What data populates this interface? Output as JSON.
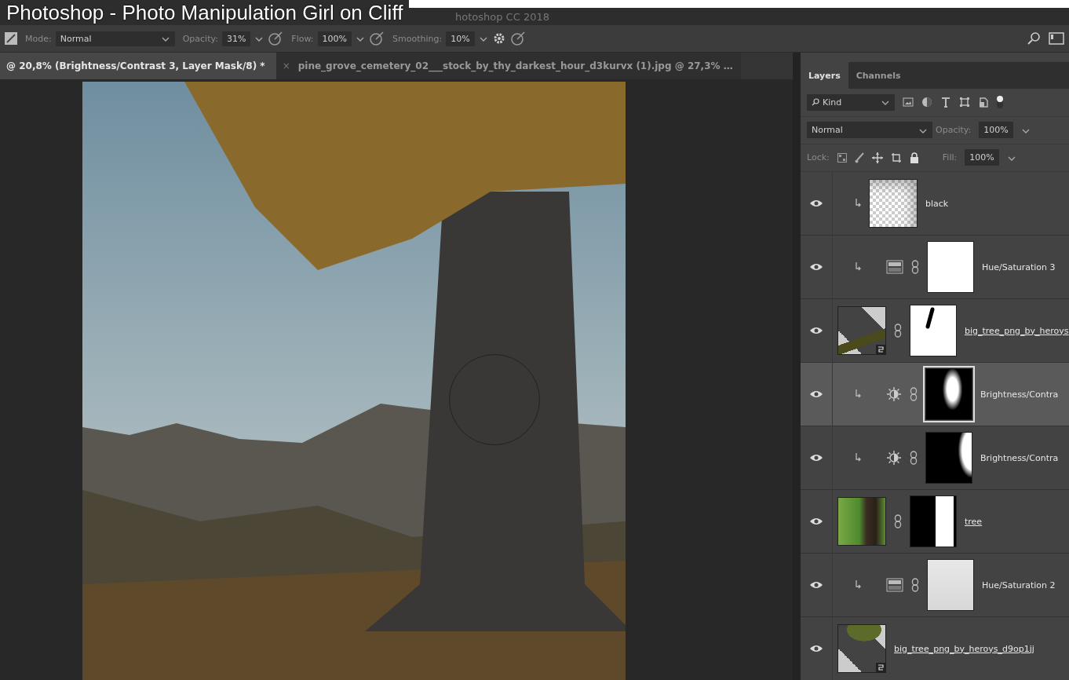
{
  "video_title": "Photoshop - Photo Manipulation Girl on Cliff",
  "window": {
    "title": "hotoshop CC 2018"
  },
  "options_bar": {
    "fields": [
      {
        "label": "Mode:",
        "value": "Normal",
        "kind": "wide"
      },
      {
        "label": "Opacity:",
        "value": "31%",
        "kind": "narrow"
      },
      {
        "label": "Flow:",
        "value": "100%",
        "kind": "narrow"
      },
      {
        "label": "Smoothing:",
        "value": "10%",
        "kind": "narrow"
      }
    ]
  },
  "document_tabs": [
    {
      "label": "@ 20,8% (Brightness/Contrast 3, Layer Mask/8) *",
      "selected": true
    },
    {
      "close": "×",
      "label": "pine_grove_cemetery_02___stock_by_thy_darkest_hour_d3kurvx (1).jpg @ 27,3% …",
      "selected": false
    }
  ],
  "panel": {
    "tabs": [
      {
        "label": "Layers",
        "selected": true
      },
      {
        "label": "Channels",
        "selected": false
      }
    ],
    "filter": "Kind",
    "blend_mode": "Normal",
    "opacity_label": "Opacity:",
    "opacity": "100%",
    "lock_label": "Lock:",
    "fill_label": "Fill:",
    "fill": "100%",
    "layers": [
      {
        "name": "black",
        "visible": true,
        "clipped": true,
        "kind": "pixel",
        "thumbnail": {
          "kind": "checker-corner"
        },
        "linked_name": false,
        "selected": false
      },
      {
        "name": "Hue/Saturation 3",
        "visible": true,
        "clipped": true,
        "kind": "hue",
        "mask": {
          "kind": "white"
        },
        "linked_name": false,
        "selected": false
      },
      {
        "name": "big_tree_png_by_heroys",
        "visible": true,
        "clipped": false,
        "kind": "smart",
        "thumbnail": {
          "kind": "checker-tree"
        },
        "mask": {
          "kind": "stroke"
        },
        "linked_name": true,
        "selected": false
      },
      {
        "name": "Brightness/Contra",
        "visible": true,
        "clipped": true,
        "kind": "brightness",
        "mask": {
          "kind": "glow-center"
        },
        "linked_name": false,
        "selected": true
      },
      {
        "name": "Brightness/Contra",
        "visible": true,
        "clipped": true,
        "kind": "brightness",
        "mask": {
          "kind": "glow-right"
        },
        "linked_name": false,
        "selected": false
      },
      {
        "name": "tree",
        "visible": true,
        "clipped": false,
        "kind": "pixel",
        "thumbnail": {
          "kind": "green-photo"
        },
        "mask": {
          "kind": "trunk"
        },
        "linked_name": true,
        "selected": false
      },
      {
        "name": "Hue/Saturation 2",
        "visible": true,
        "clipped": true,
        "kind": "hue",
        "mask": {
          "kind": "light"
        },
        "linked_name": false,
        "selected": false
      },
      {
        "name": "big_tree_png_by_heroys_d9op1jj",
        "visible": true,
        "clipped": false,
        "kind": "smart",
        "thumbnail": {
          "kind": "checker-foliage"
        },
        "linked_name": true,
        "selected": false
      }
    ]
  }
}
